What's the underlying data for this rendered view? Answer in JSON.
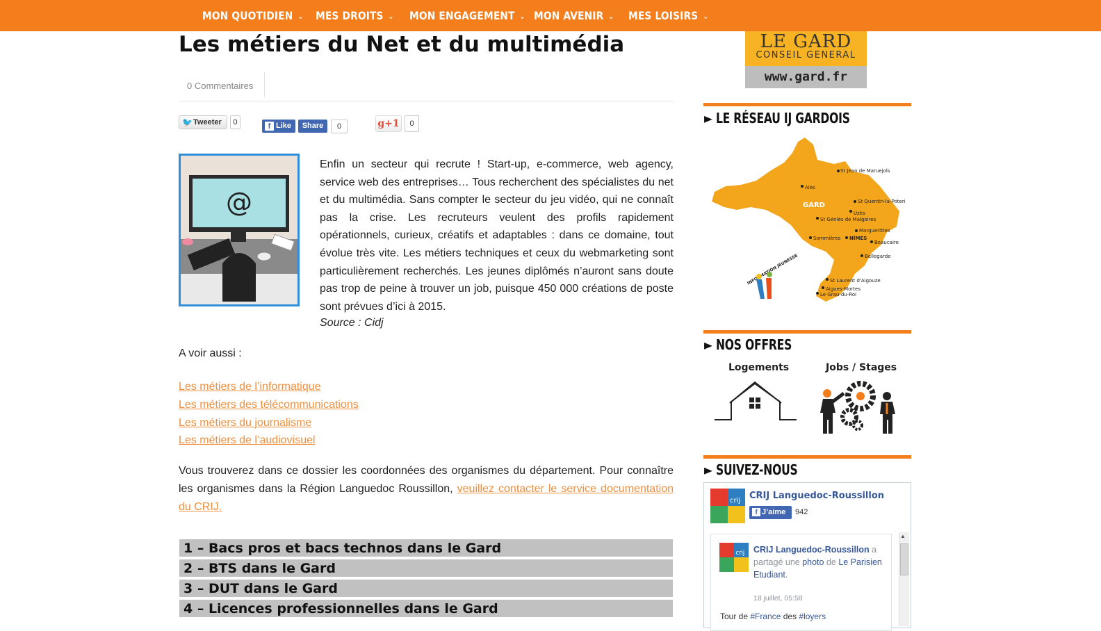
{
  "nav": {
    "items": [
      {
        "label": "MON QUOTIDIEN"
      },
      {
        "label": "MES DROITS"
      },
      {
        "label": "MON ENGAGEMENT"
      },
      {
        "label": "MON AVENIR"
      },
      {
        "label": "MES LOISIRS"
      }
    ],
    "chevron": "⌄"
  },
  "article": {
    "title": "Les métiers du Net et du multimédia",
    "comments": "0 Commentaires",
    "intro": "Enfin un secteur qui recrute ! Start-up, e-commerce, web agency, service web des entreprises… Tous recherchent des spécialistes du net et du multimédia. Sans compter le secteur du jeu vidéo, qui ne connaît pas la crise. Les recruteurs veulent des profils rapidement opérationnels, curieux, créatifs et adaptables : dans ce domaine, tout évolue très vite. Les métiers techniques et ceux du webmarketing sont particulièrement recherchés. Les jeunes diplômés n’auront sans doute pas trop de peine à trouver un job, puisque 450 000 créations de poste sont prévues d’ici à 2015.",
    "source": "Source : Cidj",
    "see_also": "A voir aussi :",
    "links": [
      "Les métiers de l’informatique",
      "Les métiers des télécommunications",
      "Les métiers du journalisme",
      "Les métiers de l’audiovisuel"
    ],
    "body2_text": "Vous trouverez dans ce dossier les coordonnées des organismes du département. Pour connaître les organismes dans la Région Languedoc Roussillon, ",
    "body2_link": "veuillez contacter le service documentation du CRIJ.",
    "image_at": "@",
    "accordions": [
      "1 – Bacs pros et bacs technos dans le Gard",
      "2 – BTS dans le Gard",
      "3 – DUT dans le Gard",
      "4 – Licences professionnelles dans le Gard"
    ]
  },
  "share": {
    "tweet_label": "Tweeter",
    "tweet_count": "0",
    "like_label": "Like",
    "share_label": "Share",
    "fb_count": "0",
    "gplus_label": "g+1",
    "gplus_count": "0"
  },
  "sidebar": {
    "logo": {
      "line1": "LE GARD",
      "line2": "CONSEIL GENERAL",
      "url": "www.gard.fr"
    },
    "reseau_title": "► LE RÉSEAU IJ GARDOIS",
    "map": {
      "region": "GARD",
      "badge": "INFORMATION JEUNESSE",
      "cities": [
        "St Jean de Maruejols",
        "Alès",
        "St Quentin-la-Poterie",
        "Uzès",
        "St Géniès de Malgoires",
        "Marguerittes",
        "Sommières",
        "NÎMES",
        "Beaucaire",
        "Bellegarde",
        "St Laurent d'Aigouze",
        "Aigues-Mortes",
        "Le Grau-du-Roi"
      ]
    },
    "offres_title": "► NOS OFFRES",
    "offres": [
      {
        "label": "Logements"
      },
      {
        "label": "Jobs / Stages"
      }
    ],
    "suivez_title": "► SUIVEZ-NOUS",
    "facebook": {
      "page_name": "CRIJ Languedoc-Roussillon",
      "like_label": "J’aime",
      "like_count": "942",
      "post_author": "CRIJ Languedoc-Roussillon",
      "post_mid": " a partagé une ",
      "post_link1": "photo",
      "post_de": " de ",
      "post_link2": "Le Parisien Etudiant",
      "post_end": ".",
      "post_date": "18 juillet, 05:58",
      "tail_text": "Tour de ",
      "tail_tag1": "#France",
      "tail_mid": " des ",
      "tail_tag2": "#loyers",
      "avatar_text": "crij"
    }
  },
  "colors": {
    "accent": "#f47d1c",
    "link": "#f08f3e",
    "fb": "#4267b2"
  }
}
